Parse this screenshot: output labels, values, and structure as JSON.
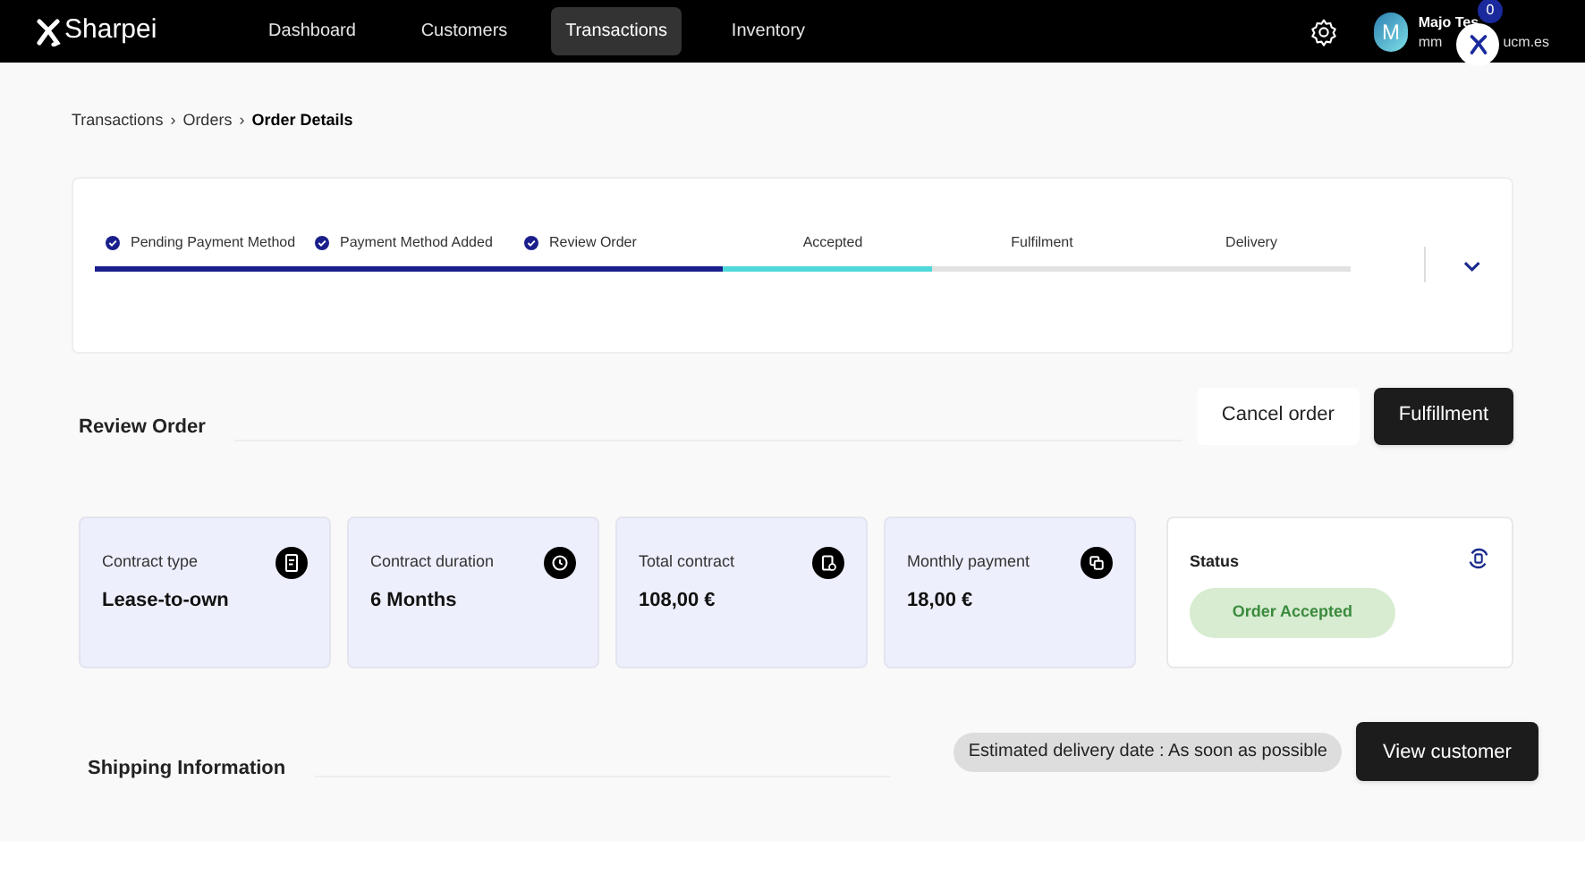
{
  "nav": {
    "logo": "Sharpei",
    "items": [
      {
        "label": "Dashboard",
        "selected": false
      },
      {
        "label": "Customers",
        "selected": false
      },
      {
        "label": "Transactions",
        "selected": true
      },
      {
        "label": "Inventory",
        "selected": false
      }
    ],
    "user": {
      "initial": "M",
      "name": "Majo Tes",
      "email_start": "mm",
      "email_end": "ucm.es",
      "badge": "0"
    }
  },
  "breadcrumb": [
    {
      "label": "Transactions",
      "current": false
    },
    {
      "separator": "›",
      "label": "Orders",
      "current": false
    },
    {
      "separator": "›",
      "label": "Order Details",
      "current": true
    }
  ],
  "steps": [
    {
      "label": "Pending Payment Method",
      "done": true,
      "current": false
    },
    {
      "label": "Payment Method Added",
      "done": true,
      "current": false
    },
    {
      "label": "Review Order",
      "done": true,
      "current": false
    },
    {
      "label": "Accepted",
      "done": false,
      "current": true
    },
    {
      "label": "Fulfilment",
      "done": false,
      "current": false
    },
    {
      "label": "Delivery",
      "done": false,
      "current": false
    }
  ],
  "review": {
    "title": "Review Order",
    "buttons": [
      {
        "label": "Cancel order",
        "kind": "secondary"
      },
      {
        "label": "Fulfillment",
        "kind": "primary"
      }
    ]
  },
  "cards": [
    {
      "label": "Contract type",
      "value": "Lease-to-own",
      "kind": "type"
    },
    {
      "label": "Contract duration",
      "value": "6 Months",
      "kind": "duration"
    },
    {
      "label": "Total contract",
      "value": "108,00 €",
      "kind": "total"
    },
    {
      "label": "Monthly payment",
      "value": "18,00 €",
      "kind": "monthly"
    }
  ],
  "status": {
    "title": "Status",
    "value": "Order Accepted",
    "color": "#d7ecd0"
  },
  "shipping": {
    "title": "Shipping Information",
    "estimate": "Estimated delivery date : As soon as possible",
    "button": "View customer"
  }
}
